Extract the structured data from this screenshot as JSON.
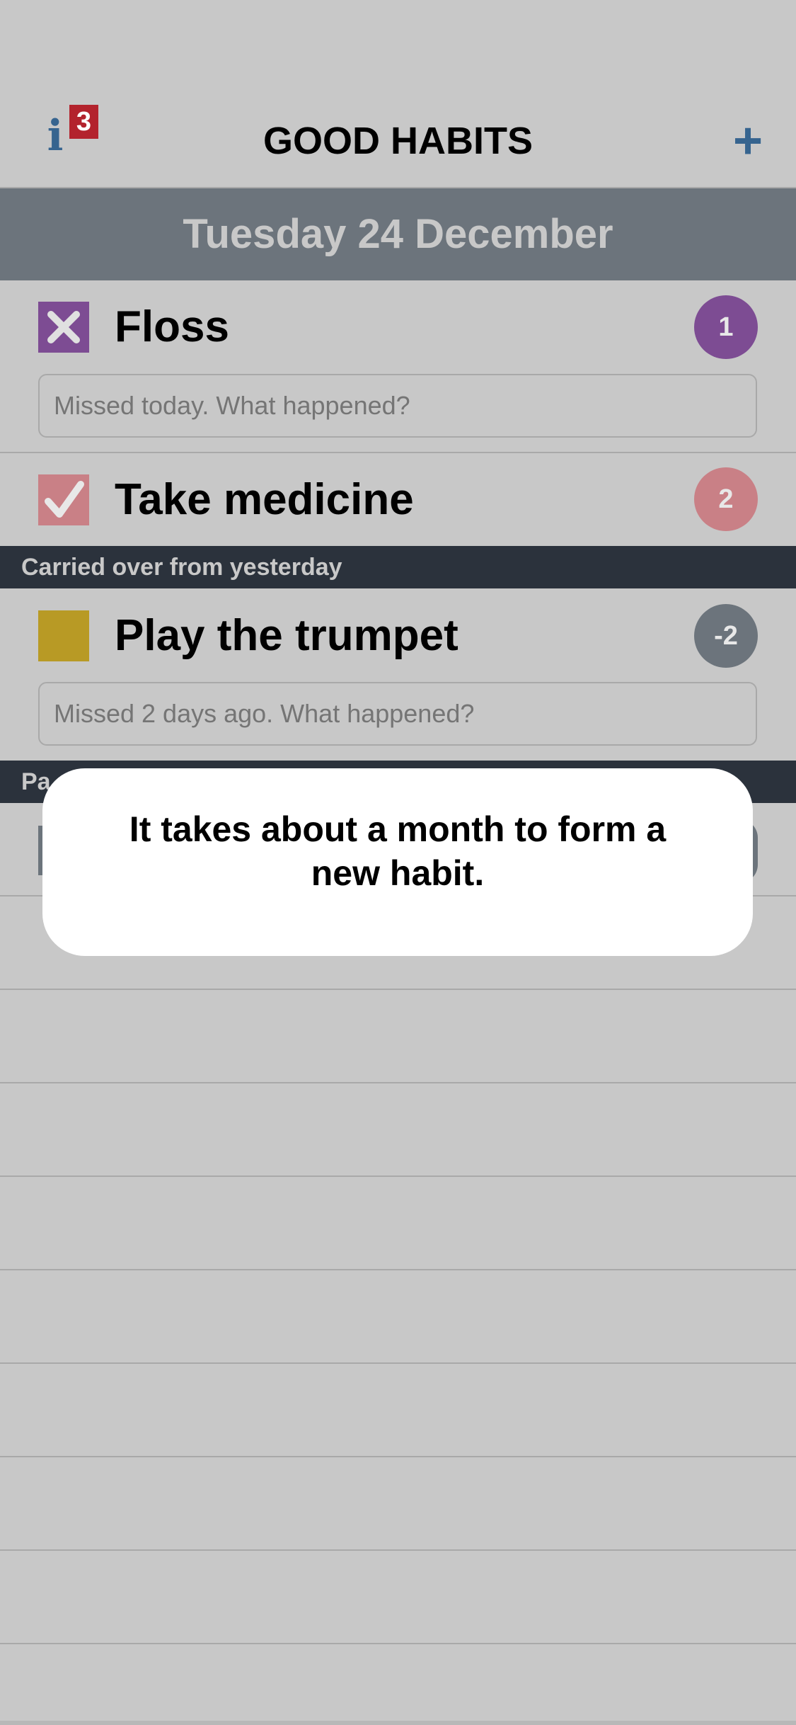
{
  "nav": {
    "info_badge_count": "3",
    "title": "GOOD HABITS",
    "add_label": "+"
  },
  "date_banner": "Tuesday 24 December",
  "habits_today": [
    {
      "name": "Floss",
      "status": "missed",
      "count": "1",
      "color": "#7d4c93",
      "note_placeholder": "Missed today. What happened?"
    },
    {
      "name": "Take medicine",
      "status": "done",
      "count": "2",
      "color": "#c98086"
    }
  ],
  "sections": {
    "carried_over": "Carried over from yesterday",
    "partial": "Pa"
  },
  "carried_over_habits": [
    {
      "name": "Play the trumpet",
      "status": "pending",
      "count": "-2",
      "color": "#b89a25",
      "note_placeholder": "Missed 2 days ago. What happened?"
    }
  ],
  "popup": {
    "message": "It takes about a month to form a new habit."
  },
  "colors": {
    "background": "#c8c8c8",
    "date_banner": "#6c747c",
    "section_header": "#2b323c",
    "accent_blue": "#36648f",
    "badge_red": "#b3232d"
  }
}
